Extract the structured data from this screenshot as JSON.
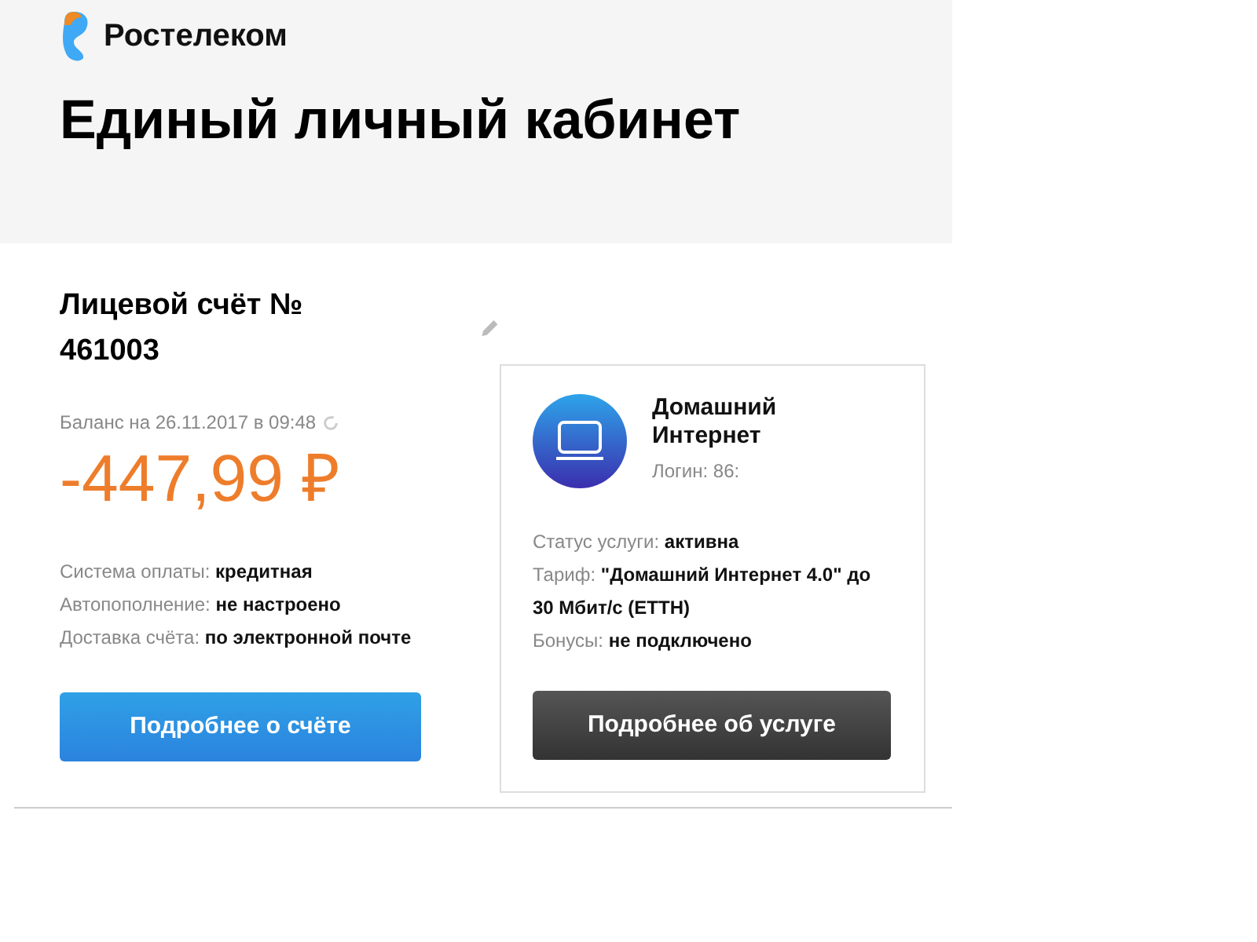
{
  "brand": {
    "name": "Ростелеком"
  },
  "page_title": "Единый личный кабинет",
  "account": {
    "title": "Лицевой счёт № 461003",
    "balance_label": "Баланс на 26.11.2017 в 09:48",
    "balance": "-447,99 ₽",
    "details": [
      {
        "label": "Система оплаты:",
        "value": "кредитная"
      },
      {
        "label": "Автопополнение:",
        "value": "не настроено"
      },
      {
        "label": "Доставка счёта:",
        "value": "по электронной почте"
      }
    ],
    "button": "Подробнее о счёте"
  },
  "service": {
    "name": "Домашний Интернет",
    "login": "Логин: 86:",
    "details": [
      {
        "label": "Статус услуги:",
        "value": "активна"
      },
      {
        "label": "Тариф:",
        "value": "\"Домашний Интернет 4.0\" до 30 Мбит/с (ETTH)"
      },
      {
        "label": "Бонусы:",
        "value": "не подключено"
      }
    ],
    "button": "Подробнее об услуге"
  }
}
